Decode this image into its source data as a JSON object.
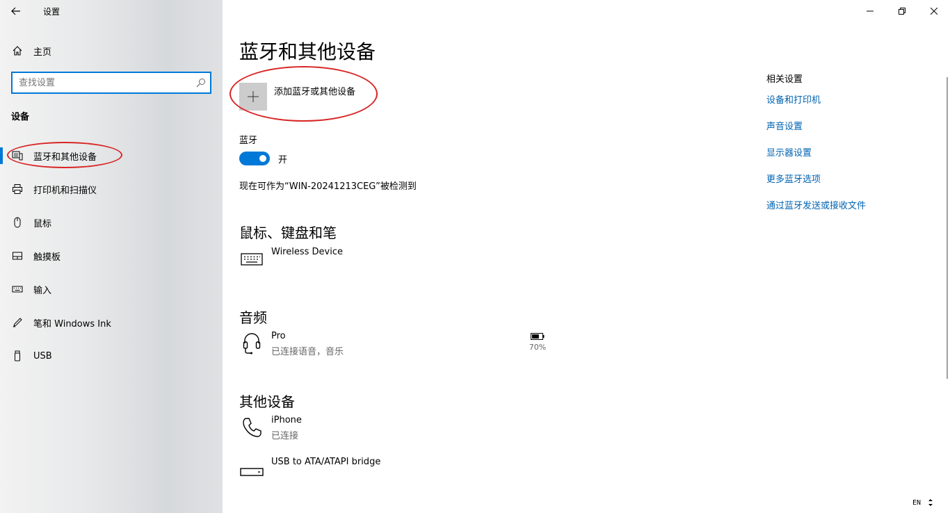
{
  "window": {
    "app_title": "设置",
    "controls": [
      "minimize",
      "restore",
      "close"
    ]
  },
  "sidebar": {
    "home_label": "主页",
    "search": {
      "placeholder": "查找设置",
      "value": ""
    },
    "section_label": "设备",
    "items": [
      {
        "label": "蓝牙和其他设备",
        "icon": "bluetooth-devices-icon",
        "selected": true
      },
      {
        "label": "打印机和扫描仪",
        "icon": "printer-icon"
      },
      {
        "label": "鼠标",
        "icon": "mouse-icon"
      },
      {
        "label": "触摸板",
        "icon": "touchpad-icon"
      },
      {
        "label": "输入",
        "icon": "keyboard-icon"
      },
      {
        "label": "笔和 Windows Ink",
        "icon": "pen-icon"
      },
      {
        "label": "USB",
        "icon": "usb-icon"
      }
    ]
  },
  "main": {
    "title": "蓝牙和其他设备",
    "add_device_label": "添加蓝牙或其他设备",
    "bluetooth": {
      "label": "蓝牙",
      "toggle_state": "开",
      "toggle_on": true,
      "discoverable_text": "现在可作为“WIN-20241213CEG”被检测到"
    },
    "groups": {
      "input": {
        "title": "鼠标、键盘和笔",
        "devices": [
          {
            "name": "Wireless Device",
            "icon": "keyboard-icon"
          }
        ]
      },
      "audio": {
        "title": "音频",
        "devices": [
          {
            "name": "Pro",
            "status": "已连接语音，音乐",
            "icon": "headset-icon",
            "battery": "70%",
            "battery_level": 0.7
          }
        ]
      },
      "other": {
        "title": "其他设备",
        "devices": [
          {
            "name": "iPhone",
            "status": "已连接",
            "icon": "phone-icon"
          },
          {
            "name": "USB to ATA/ATAPI bridge",
            "icon": "drive-icon"
          }
        ]
      }
    }
  },
  "related": {
    "title": "相关设置",
    "links": [
      "设备和打印机",
      "声音设置",
      "显示器设置",
      "更多蓝牙选项",
      "通过蓝牙发送或接收文件"
    ]
  },
  "ime": {
    "language": "EN"
  },
  "colors": {
    "accent": "#0078d7",
    "link": "#0063b1",
    "annotation": "#d82424"
  }
}
